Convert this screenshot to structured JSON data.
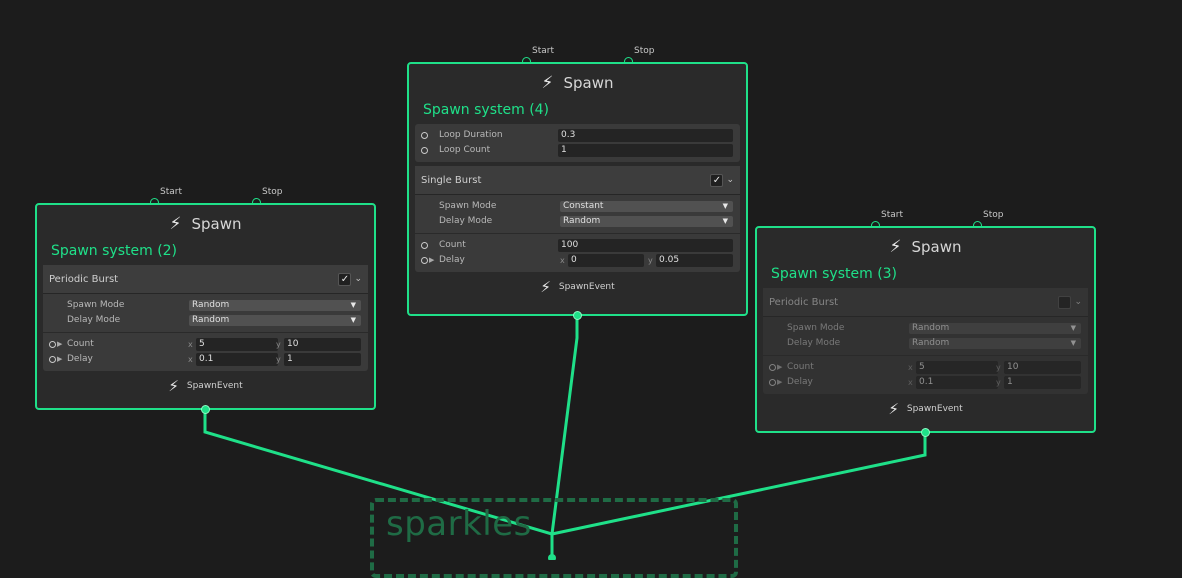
{
  "group": {
    "title": "sparkles"
  },
  "nodes": {
    "node2": {
      "header": "Spawn",
      "title": "Spawn system (2)",
      "start_label": "Start",
      "stop_label": "Stop",
      "block": {
        "name": "Periodic Burst",
        "enabled": true,
        "checkmark": "✓",
        "spawn_mode_label": "Spawn Mode",
        "spawn_mode_value": "Random",
        "delay_mode_label": "Delay Mode",
        "delay_mode_value": "Random",
        "count_label": "Count",
        "count_x": "5",
        "count_y": "10",
        "delay_label": "Delay",
        "delay_x": "0.1",
        "delay_y": "1"
      },
      "footer": "SpawnEvent"
    },
    "node4": {
      "header": "Spawn",
      "title": "Spawn system (4)",
      "start_label": "Start",
      "stop_label": "Stop",
      "loop_duration_label": "Loop Duration",
      "loop_duration_value": "0.3",
      "loop_count_label": "Loop Count",
      "loop_count_value": "1",
      "block": {
        "name": "Single Burst",
        "enabled": true,
        "checkmark": "✓",
        "spawn_mode_label": "Spawn Mode",
        "spawn_mode_value": "Constant",
        "delay_mode_label": "Delay Mode",
        "delay_mode_value": "Random",
        "count_label": "Count",
        "count_value": "100",
        "delay_label": "Delay",
        "delay_x": "0",
        "delay_y": "0.05"
      },
      "footer": "SpawnEvent"
    },
    "node3": {
      "header": "Spawn",
      "title": "Spawn system (3)",
      "start_label": "Start",
      "stop_label": "Stop",
      "block": {
        "name": "Periodic Burst",
        "enabled": false,
        "spawn_mode_label": "Spawn Mode",
        "spawn_mode_value": "Random",
        "delay_mode_label": "Delay Mode",
        "delay_mode_value": "Random",
        "count_label": "Count",
        "count_x": "5",
        "count_y": "10",
        "delay_label": "Delay",
        "delay_x": "0.1",
        "delay_y": "1"
      },
      "footer": "SpawnEvent"
    }
  },
  "axis": {
    "x": "x",
    "y": "y"
  },
  "icons": {
    "bolt": "lightning-bolt-icon",
    "chevron": "chevron-down-icon",
    "dropdown": "dropdown-arrow-icon"
  },
  "colors": {
    "accent": "#1fe089",
    "background": "#1c1c1c",
    "node_body": "#2a2a2a",
    "group": "#1f6b45"
  }
}
